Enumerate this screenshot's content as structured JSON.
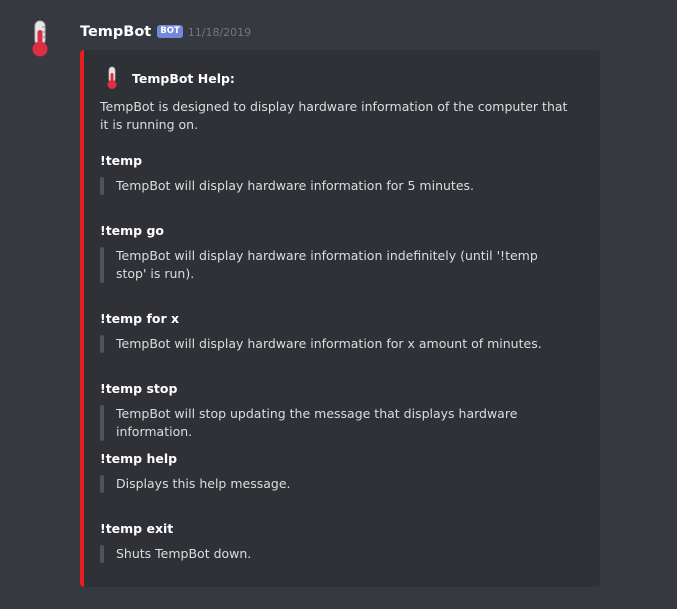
{
  "message": {
    "username": "TempBot",
    "bot_tag": "BOT",
    "timestamp": "11/18/2019",
    "avatar_icon": "thermometer-icon"
  },
  "embed": {
    "accent_color": "#e91e1e",
    "author_icon": "thermometer-icon",
    "author": "TempBot Help:",
    "description": "TempBot is designed to display hardware information of the computer that it is running on.",
    "fields": [
      {
        "name": "!temp",
        "value": "TempBot will display hardware information for 5 minutes."
      },
      {
        "name": "!temp go",
        "value": "TempBot will display hardware information indefinitely (until '!temp stop' is run)."
      },
      {
        "name": "!temp for x",
        "value": "TempBot will display hardware information for x amount of minutes."
      },
      {
        "name": "!temp stop",
        "value": "TempBot will stop updating the message that displays hardware information."
      },
      {
        "name": "!temp help",
        "value": "Displays this help message."
      },
      {
        "name": "!temp exit",
        "value": "Shuts TempBot down."
      }
    ]
  }
}
